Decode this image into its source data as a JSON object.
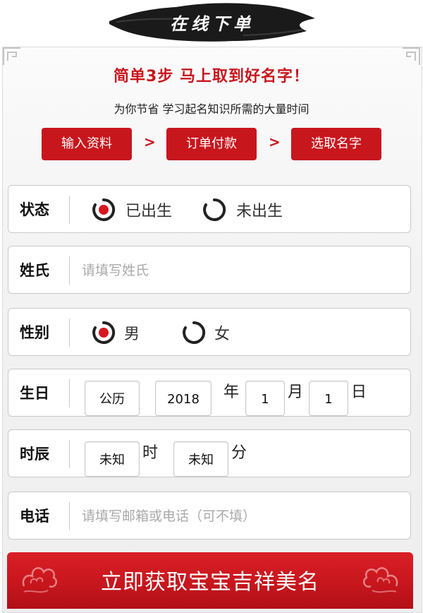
{
  "header": {
    "title": "在线下单"
  },
  "intro": {
    "headline": "简单3步 马上取到好名字！",
    "subline": "为你节省 学习起名知识所需的大量时间"
  },
  "steps": [
    {
      "label": "输入资料"
    },
    {
      "label": "订单付款"
    },
    {
      "label": "选取名字"
    }
  ],
  "step_separator": ">",
  "form": {
    "status": {
      "label": "状态",
      "options": [
        "已出生",
        "未出生"
      ],
      "selected": "已出生"
    },
    "surname": {
      "label": "姓氏",
      "placeholder": "请填写姓氏",
      "value": ""
    },
    "gender": {
      "label": "性别",
      "options": [
        "男",
        "女"
      ],
      "selected": "男"
    },
    "birthday": {
      "label": "生日",
      "calendar": "公历",
      "year": "2018",
      "year_unit": "年",
      "month": "1",
      "month_unit": "月",
      "day": "1",
      "day_unit": "日"
    },
    "birth_time": {
      "label": "时辰",
      "hour": "未知",
      "hour_unit": "时",
      "minute": "未知",
      "minute_unit": "分"
    },
    "phone": {
      "label": "电话",
      "placeholder": "请填写邮箱或电话（可不填）",
      "value": ""
    }
  },
  "submit": {
    "label": "立即获取宝宝吉祥美名"
  },
  "colors": {
    "accent": "#c8161d",
    "banner": "#1a1a1a",
    "border": "#c9c9c9"
  },
  "icons": [
    "brush-banner",
    "corner-ornament",
    "radio-selected-icon",
    "radio-unselected-icon",
    "cloud-ornament-icon"
  ]
}
